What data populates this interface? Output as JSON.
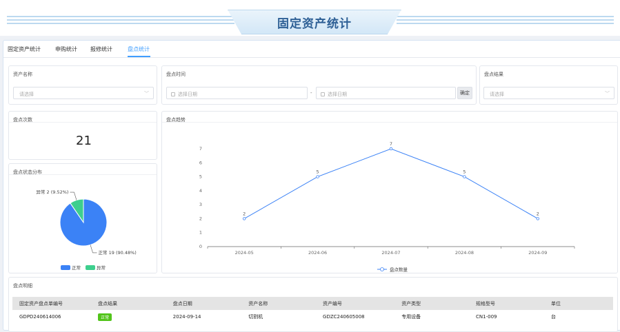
{
  "header": {
    "title": "固定资产统计"
  },
  "tabs": [
    {
      "label": "固定资产统计",
      "active": false
    },
    {
      "label": "申购统计",
      "active": false
    },
    {
      "label": "报修统计",
      "active": false
    },
    {
      "label": "盘点统计",
      "active": true
    }
  ],
  "filters": {
    "asset_name": {
      "label": "资产名称",
      "placeholder": "请选择"
    },
    "inventory_time": {
      "label": "盘点时间",
      "start_placeholder": "选择日期",
      "separator": "-",
      "end_placeholder": "选择日期",
      "confirm": "确定"
    },
    "inventory_result": {
      "label": "盘点结果",
      "placeholder": "请选择"
    }
  },
  "count_card": {
    "label": "盘点次数",
    "value": "21"
  },
  "pie_card": {
    "title": "盘点状态分布",
    "chart_data": {
      "type": "pie",
      "slices": [
        {
          "name": "正常",
          "value": 19,
          "label": "正常 19 (90.48%)",
          "color": "#3b82f6"
        },
        {
          "name": "异常",
          "value": 2,
          "label": "异常 2 (9.52%)",
          "color": "#3ecf8e"
        }
      ],
      "legend": "bottom"
    }
  },
  "trend_card": {
    "title": "盘点趋势",
    "chart_data": {
      "type": "line",
      "categories": [
        "2024-05",
        "2024-06",
        "2024-07",
        "2024-08",
        "2024-09"
      ],
      "series": [
        {
          "name": "盘点数量",
          "values": [
            2,
            5,
            7,
            5,
            2
          ],
          "color": "#3b82f6"
        }
      ],
      "ylim": [
        0,
        7
      ],
      "yticks": [
        "0",
        "1",
        "2",
        "3",
        "4",
        "5",
        "6",
        "7"
      ],
      "legend": "bottom"
    }
  },
  "detail": {
    "title": "盘点明细",
    "columns": [
      "固定资产盘点单编号",
      "盘点结果",
      "盘点日期",
      "资产名称",
      "资产编号",
      "资产类型",
      "规格型号",
      "单位"
    ],
    "rows": [
      [
        "GDPD240614006",
        "正常",
        "2024-09-14",
        "切割机",
        "GDZC240605008",
        "专用设备",
        "CN1-009",
        "台"
      ]
    ]
  }
}
